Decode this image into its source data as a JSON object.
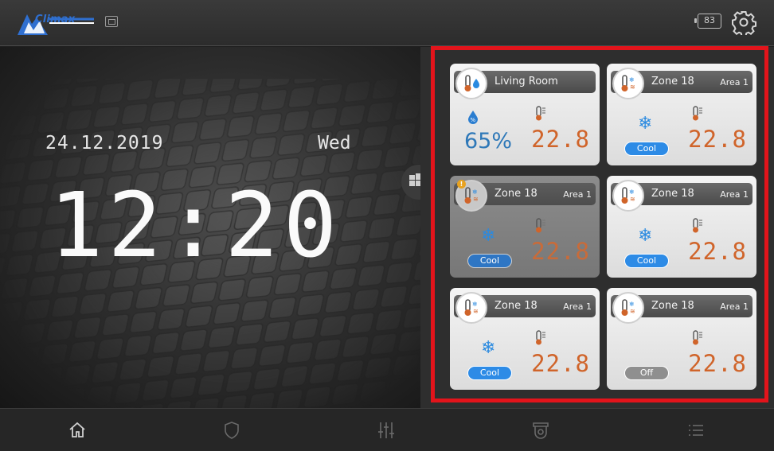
{
  "header": {
    "logo_text": "Climax",
    "battery": "83",
    "icons": [
      "climax-logo",
      "network-icon",
      "battery-icon",
      "gear-icon"
    ]
  },
  "clock": {
    "date": "24.12.2019",
    "weekday": "Wed",
    "time": "12:20"
  },
  "zones": [
    {
      "name": "Living Room",
      "area": "",
      "humidity": "65%",
      "temperature": "22.8",
      "mode": "",
      "type": "humidity-temperature",
      "dimmed": false,
      "warning": false
    },
    {
      "name": "Zone 18",
      "area": "Area 1",
      "humidity": "",
      "temperature": "22.8",
      "mode": "Cool",
      "type": "hvac",
      "dimmed": false,
      "warning": false
    },
    {
      "name": "Zone 18",
      "area": "Area 1",
      "humidity": "",
      "temperature": "22.8",
      "mode": "Cool",
      "type": "hvac",
      "dimmed": true,
      "warning": true
    },
    {
      "name": "Zone 18",
      "area": "Area 1",
      "humidity": "",
      "temperature": "22.8",
      "mode": "Cool",
      "type": "hvac",
      "dimmed": false,
      "warning": false
    },
    {
      "name": "Zone 18",
      "area": "Area 1",
      "humidity": "",
      "temperature": "22.8",
      "mode": "Cool",
      "type": "hvac",
      "dimmed": false,
      "warning": false
    },
    {
      "name": "Zone 18",
      "area": "Area 1",
      "humidity": "",
      "temperature": "22.8",
      "mode": "Off",
      "type": "hvac",
      "dimmed": false,
      "warning": false
    }
  ],
  "nav": [
    "home-icon",
    "shield-icon",
    "sliders-icon",
    "camera-icon",
    "list-icon"
  ],
  "colors": {
    "accent_blue": "#2d8be6",
    "temperature_orange": "#d0642a",
    "highlight_red": "#e3141b"
  }
}
